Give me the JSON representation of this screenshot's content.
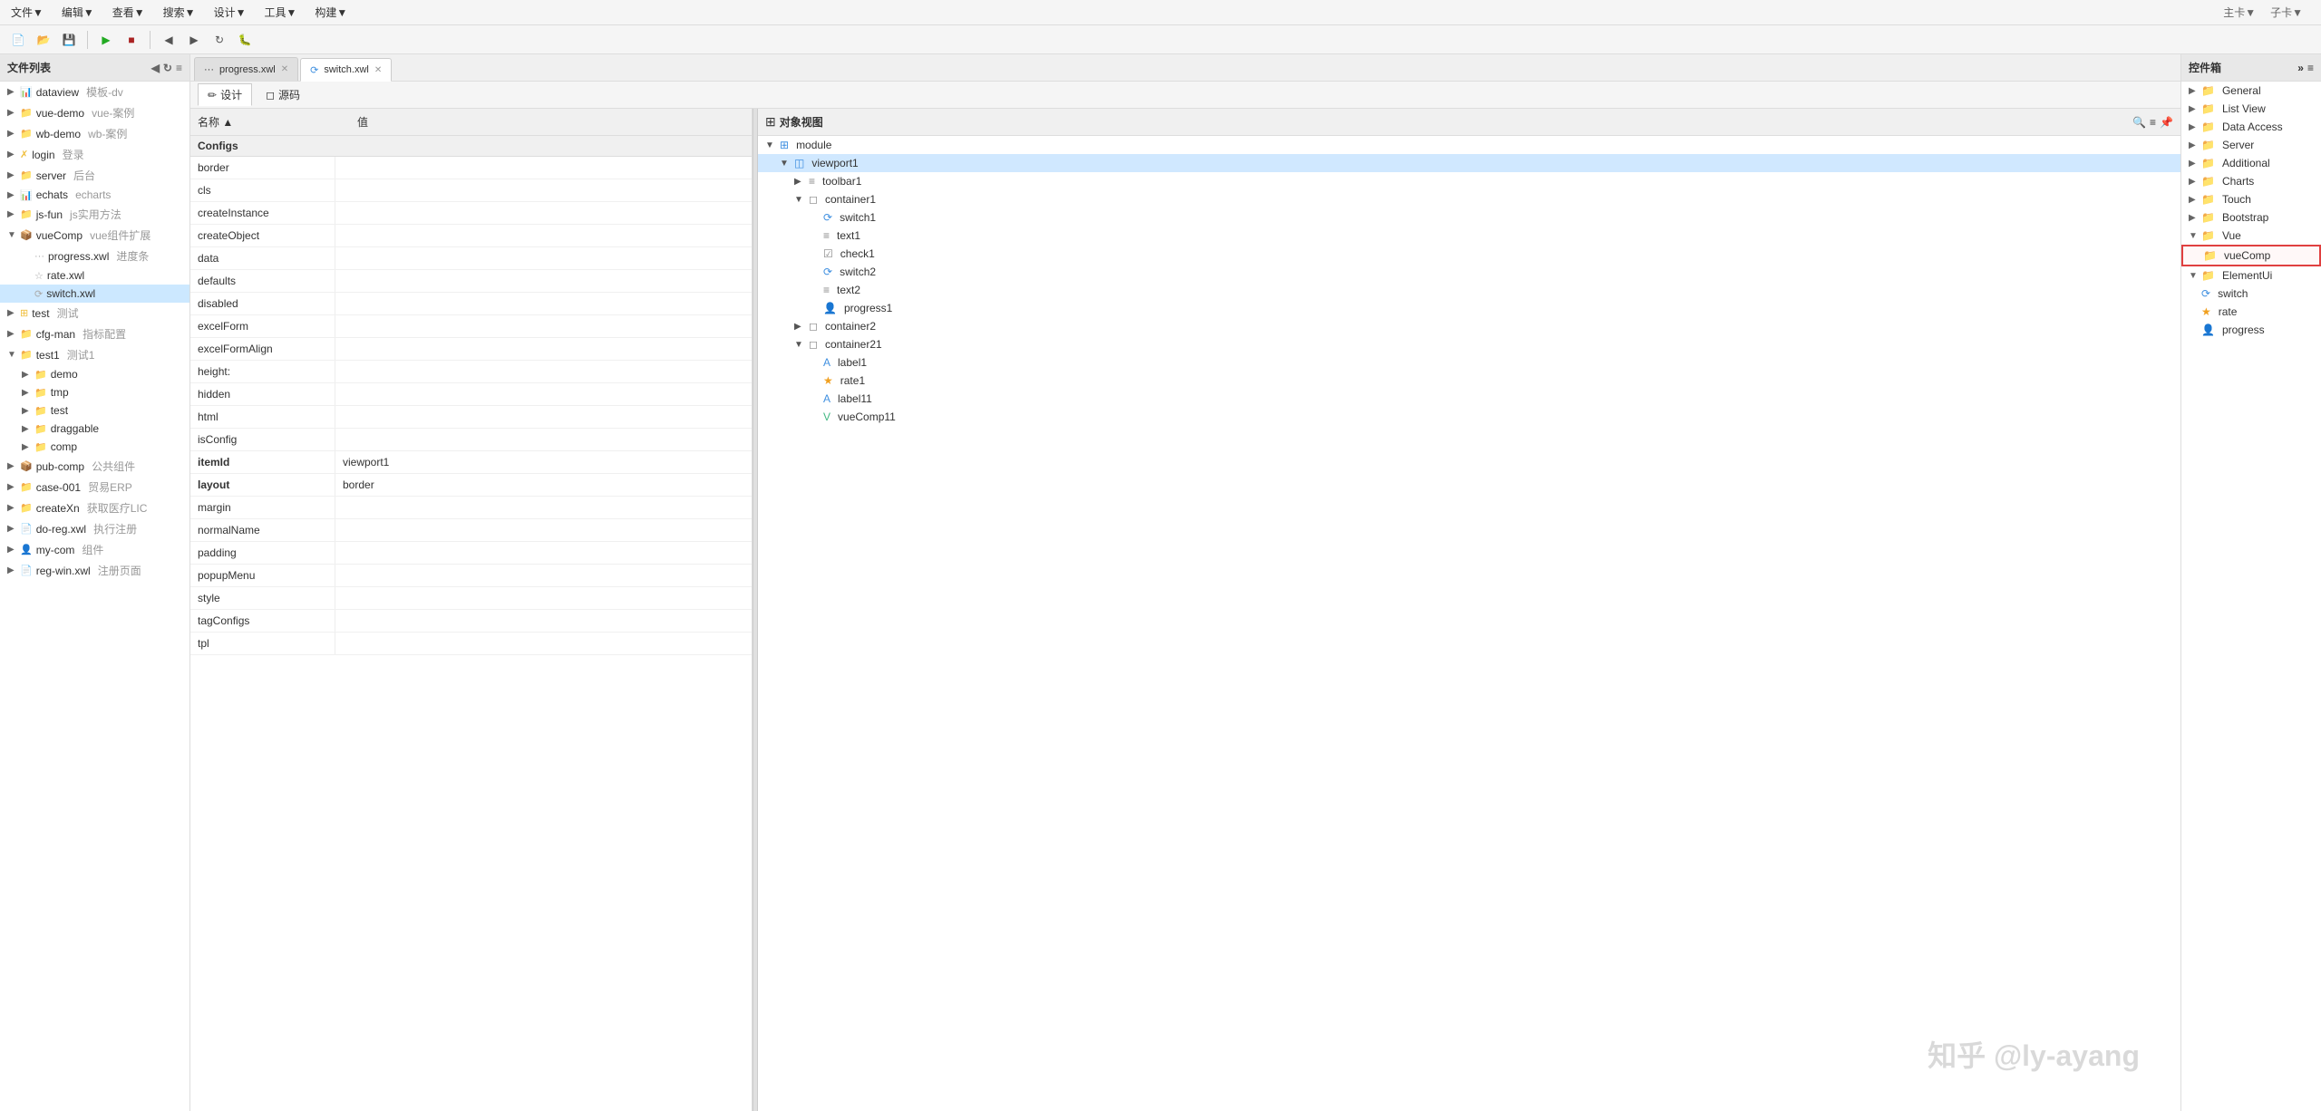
{
  "menubar": {
    "items": [
      "文件▼",
      "编辑▼",
      "查看▼",
      "搜索▼",
      "设计▼",
      "工具▼",
      "构建▼"
    ]
  },
  "top_right_tabs": [
    "主卡▼",
    "子卡▼"
  ],
  "tabs": [
    {
      "label": "... progress.xwl",
      "active": false,
      "closeable": true
    },
    {
      "label": "⟳ switch.xwl",
      "active": true,
      "closeable": true
    }
  ],
  "design_tabs": [
    {
      "label": "✏ 设计",
      "active": true
    },
    {
      "label": "◻ 源码",
      "active": false
    }
  ],
  "file_panel": {
    "title": "文件列表",
    "items": [
      {
        "indent": 0,
        "arrow": "▶",
        "icon": "📊",
        "label": "dataview",
        "sublabel": "模板-dv",
        "type": "folder"
      },
      {
        "indent": 0,
        "arrow": "▶",
        "icon": "📁",
        "label": "vue-demo",
        "sublabel": "vue-案例",
        "type": "folder"
      },
      {
        "indent": 0,
        "arrow": "▶",
        "icon": "📁",
        "label": "wb-demo",
        "sublabel": "wb-案例",
        "type": "folder"
      },
      {
        "indent": 0,
        "arrow": "▶",
        "icon": "✗",
        "label": "login",
        "sublabel": "登录",
        "type": "folder"
      },
      {
        "indent": 0,
        "arrow": "▶",
        "icon": "📁",
        "label": "server",
        "sublabel": "后台",
        "type": "folder"
      },
      {
        "indent": 0,
        "arrow": "▶",
        "icon": "📊",
        "label": "echats",
        "sublabel": "echarts",
        "type": "folder"
      },
      {
        "indent": 0,
        "arrow": "▶",
        "icon": "📁",
        "label": "js-fun",
        "sublabel": "js实用方法",
        "type": "folder"
      },
      {
        "indent": 0,
        "arrow": "▼",
        "icon": "📦",
        "label": "vueComp",
        "sublabel": "vue组件扩展",
        "type": "folder",
        "open": true
      },
      {
        "indent": 1,
        "arrow": "",
        "icon": "···",
        "label": "progress.xwl",
        "sublabel": "进度条",
        "type": "file"
      },
      {
        "indent": 1,
        "arrow": "",
        "icon": "☆",
        "label": "rate.xwl",
        "sublabel": "",
        "type": "file"
      },
      {
        "indent": 1,
        "arrow": "",
        "icon": "⟳",
        "label": "switch.xwl",
        "sublabel": "",
        "type": "file",
        "selected": true
      },
      {
        "indent": 0,
        "arrow": "▶",
        "icon": "⊞",
        "label": "test",
        "sublabel": "测试",
        "type": "folder"
      },
      {
        "indent": 0,
        "arrow": "▶",
        "icon": "📁",
        "label": "cfg-man",
        "sublabel": "指标配置",
        "type": "folder"
      },
      {
        "indent": 0,
        "arrow": "▼",
        "icon": "📁",
        "label": "test1",
        "sublabel": "测试1",
        "type": "folder",
        "open": true
      },
      {
        "indent": 1,
        "arrow": "▶",
        "icon": "📁",
        "label": "demo",
        "sublabel": "",
        "type": "folder"
      },
      {
        "indent": 1,
        "arrow": "▶",
        "icon": "📁",
        "label": "tmp",
        "sublabel": "",
        "type": "folder"
      },
      {
        "indent": 1,
        "arrow": "▶",
        "icon": "📁",
        "label": "test",
        "sublabel": "",
        "type": "folder"
      },
      {
        "indent": 1,
        "arrow": "▶",
        "icon": "📁",
        "label": "draggable",
        "sublabel": "",
        "type": "folder"
      },
      {
        "indent": 1,
        "arrow": "▶",
        "icon": "📁",
        "label": "comp",
        "sublabel": "",
        "type": "folder"
      },
      {
        "indent": 0,
        "arrow": "▶",
        "icon": "📦",
        "label": "pub-comp",
        "sublabel": "公共组件",
        "type": "folder"
      },
      {
        "indent": 0,
        "arrow": "▶",
        "icon": "📁",
        "label": "case-001",
        "sublabel": "贸易ERP",
        "type": "folder"
      },
      {
        "indent": 0,
        "arrow": "▶",
        "icon": "📁",
        "label": "createXn",
        "sublabel": "获取医疗LIC",
        "type": "folder"
      },
      {
        "indent": 0,
        "arrow": "▶",
        "icon": "📄",
        "label": "do-reg.xwl",
        "sublabel": "执行注册",
        "type": "file"
      },
      {
        "indent": 0,
        "arrow": "▶",
        "icon": "👤",
        "label": "my-com",
        "sublabel": "组件",
        "type": "folder"
      },
      {
        "indent": 0,
        "arrow": "▶",
        "icon": "📄",
        "label": "reg-win.xwl",
        "sublabel": "注册页面",
        "type": "file"
      }
    ]
  },
  "props_panel": {
    "col_name": "名称 ▲",
    "col_value": "值",
    "section": "Configs",
    "rows": [
      {
        "name": "border",
        "value": "",
        "bold": false
      },
      {
        "name": "cls",
        "value": "",
        "bold": false
      },
      {
        "name": "createInstance",
        "value": "",
        "bold": false
      },
      {
        "name": "createObject",
        "value": "",
        "bold": false
      },
      {
        "name": "data",
        "value": "",
        "bold": false
      },
      {
        "name": "defaults",
        "value": "",
        "bold": false
      },
      {
        "name": "disabled",
        "value": "",
        "bold": false
      },
      {
        "name": "excelForm",
        "value": "",
        "bold": false
      },
      {
        "name": "excelFormAlign",
        "value": "",
        "bold": false
      },
      {
        "name": "height:",
        "value": "",
        "bold": false
      },
      {
        "name": "hidden",
        "value": "",
        "bold": false
      },
      {
        "name": "html",
        "value": "",
        "bold": false
      },
      {
        "name": "isConfig",
        "value": "",
        "bold": false
      },
      {
        "name": "itemId",
        "value": "viewport1",
        "bold": true
      },
      {
        "name": "layout",
        "value": "border",
        "bold": true
      },
      {
        "name": "margin",
        "value": "",
        "bold": false
      },
      {
        "name": "normalName",
        "value": "",
        "bold": false
      },
      {
        "name": "padding",
        "value": "",
        "bold": false
      },
      {
        "name": "popupMenu",
        "value": "",
        "bold": false
      },
      {
        "name": "style",
        "value": "",
        "bold": false
      },
      {
        "name": "tagConfigs",
        "value": "",
        "bold": false
      },
      {
        "name": "tpl",
        "value": "",
        "bold": false
      }
    ]
  },
  "obj_panel": {
    "title": "对象视图",
    "items": [
      {
        "indent": 0,
        "arrow": "▼",
        "icon": "⊞",
        "label": "module",
        "type": "module"
      },
      {
        "indent": 1,
        "arrow": "▼",
        "icon": "◫",
        "label": "viewport1",
        "type": "viewport",
        "selected": true
      },
      {
        "indent": 2,
        "arrow": "▶",
        "icon": "≡",
        "label": "toolbar1",
        "type": "toolbar"
      },
      {
        "indent": 2,
        "arrow": "▼",
        "icon": "◻",
        "label": "container1",
        "type": "container"
      },
      {
        "indent": 3,
        "arrow": "",
        "icon": "⟳",
        "label": "switch1",
        "type": "switch"
      },
      {
        "indent": 3,
        "arrow": "",
        "icon": "≡",
        "label": "text1",
        "type": "text"
      },
      {
        "indent": 3,
        "arrow": "",
        "icon": "☑",
        "label": "check1",
        "type": "check"
      },
      {
        "indent": 3,
        "arrow": "",
        "icon": "⟳",
        "label": "switch2",
        "type": "switch"
      },
      {
        "indent": 3,
        "arrow": "",
        "icon": "≡",
        "label": "text2",
        "type": "text"
      },
      {
        "indent": 3,
        "arrow": "",
        "icon": "👤",
        "label": "progress1",
        "type": "progress"
      },
      {
        "indent": 2,
        "arrow": "▶",
        "icon": "◻",
        "label": "container2",
        "type": "container"
      },
      {
        "indent": 2,
        "arrow": "▼",
        "icon": "◻",
        "label": "container21",
        "type": "container"
      },
      {
        "indent": 3,
        "arrow": "",
        "icon": "A",
        "label": "label1",
        "type": "label"
      },
      {
        "indent": 3,
        "arrow": "",
        "icon": "★",
        "label": "rate1",
        "type": "rate"
      },
      {
        "indent": 3,
        "arrow": "",
        "icon": "A",
        "label": "label11",
        "type": "label"
      },
      {
        "indent": 3,
        "arrow": "",
        "icon": "V",
        "label": "vueComp11",
        "type": "vue"
      }
    ]
  },
  "comp_panel": {
    "title": "控件箱",
    "items": [
      {
        "indent": 0,
        "arrow": "▶",
        "icon": "📁",
        "label": "General",
        "type": "folder"
      },
      {
        "indent": 0,
        "arrow": "▶",
        "icon": "📁",
        "label": "List View",
        "type": "folder"
      },
      {
        "indent": 0,
        "arrow": "▶",
        "icon": "📁",
        "label": "Data Access",
        "type": "folder"
      },
      {
        "indent": 0,
        "arrow": "▶",
        "icon": "📁",
        "label": "Server",
        "type": "folder"
      },
      {
        "indent": 0,
        "arrow": "▶",
        "icon": "📁",
        "label": "Additional",
        "type": "folder"
      },
      {
        "indent": 0,
        "arrow": "▶",
        "icon": "📁",
        "label": "Charts",
        "type": "folder"
      },
      {
        "indent": 0,
        "arrow": "▶",
        "icon": "📁",
        "label": "Touch",
        "type": "folder"
      },
      {
        "indent": 0,
        "arrow": "▶",
        "icon": "📁",
        "label": "Bootstrap",
        "type": "folder"
      },
      {
        "indent": 0,
        "arrow": "▼",
        "icon": "📁",
        "label": "Vue",
        "type": "folder",
        "open": true
      },
      {
        "indent": 1,
        "arrow": "",
        "icon": "📁",
        "label": "vueComp",
        "type": "folder",
        "highlighted": true
      },
      {
        "indent": 0,
        "arrow": "▼",
        "icon": "📁",
        "label": "ElementUi",
        "type": "folder",
        "open": true
      },
      {
        "indent": 1,
        "arrow": "",
        "icon": "⟳",
        "label": "switch",
        "type": "switch"
      },
      {
        "indent": 1,
        "arrow": "",
        "icon": "★",
        "label": "rate",
        "type": "rate"
      },
      {
        "indent": 1,
        "arrow": "",
        "icon": "👤",
        "label": "progress",
        "type": "progress"
      }
    ]
  },
  "watermark": "知乎 @ly-ayang"
}
